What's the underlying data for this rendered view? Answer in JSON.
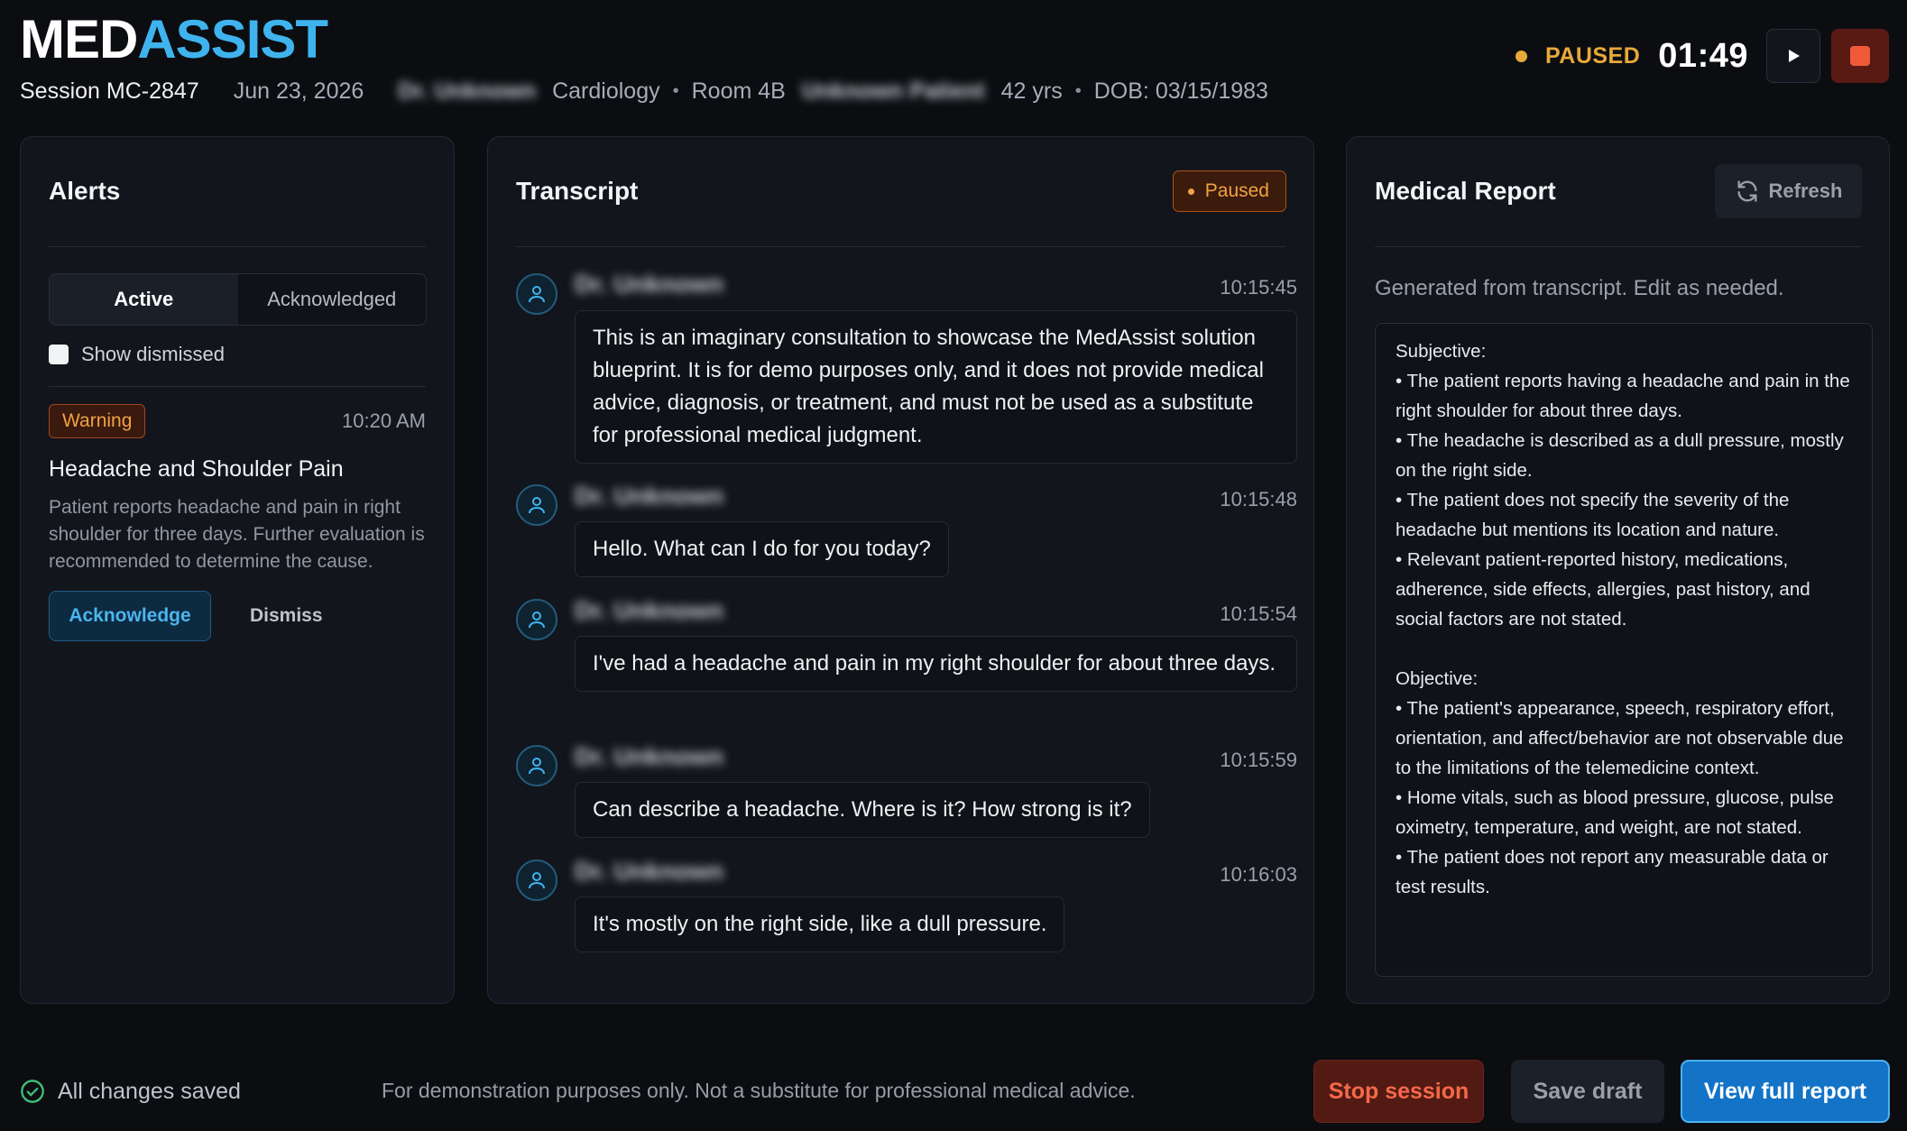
{
  "app": {
    "logo_part1": "MED",
    "logo_part2": "ASSIST"
  },
  "session": {
    "id": "Session MC-2847",
    "date": "Jun 23, 2026",
    "doctor": "Dr. Unknown",
    "department": "Cardiology",
    "room": "Room 4B",
    "patient": "Unknown Patient",
    "age": "42 yrs",
    "dob": "DOB: 03/15/1983"
  },
  "status": {
    "label": "PAUSED",
    "timer": "01:49"
  },
  "alerts": {
    "title": "Alerts",
    "tabs": [
      {
        "label": "Active",
        "active": true
      },
      {
        "label": "Acknowledged",
        "active": false
      }
    ],
    "show_dismissed": "Show dismissed",
    "items": [
      {
        "severity": "Warning",
        "time": "10:20 AM",
        "title": "Headache and Shoulder Pain",
        "body": "Patient reports headache and pain in right shoulder for three days. Further evaluation is recommended to determine the cause.",
        "acknowledge": "Acknowledge",
        "dismiss": "Dismiss"
      }
    ]
  },
  "transcript": {
    "title": "Transcript",
    "badge": "Paused",
    "messages": [
      {
        "speaker": "Dr. Unknown",
        "time": "10:15:45",
        "text": "This is an imaginary consultation to showcase the MedAssist solution blueprint. It is for demo purposes only, and it does not provide medical advice, diagnosis, or treatment, and must not be used as a substitute for professional medical judgment."
      },
      {
        "speaker": "Dr. Unknown",
        "time": "10:15:48",
        "text": "Hello. What can I do for you today?"
      },
      {
        "speaker": "Dr. Unknown",
        "time": "10:15:54",
        "text": "I've had a headache and pain in my right shoulder for about three days."
      },
      {
        "speaker": "Dr. Unknown",
        "time": "10:15:59",
        "text": "Can describe a headache. Where is it? How strong is it?"
      },
      {
        "speaker": "Dr. Unknown",
        "time": "10:16:03",
        "text": "It's mostly on the right side, like a dull pressure."
      }
    ]
  },
  "report": {
    "title": "Medical Report",
    "refresh": "Refresh",
    "note": "Generated from transcript. Edit as needed.",
    "subjective_heading": "Subjective:",
    "subjective": [
      "• The patient reports having a headache and pain in the right shoulder for about three days.",
      "• The headache is described as a dull pressure, mostly on the right side.",
      "• The patient does not specify the severity of the headache but mentions its location and nature.",
      "• Relevant patient-reported history, medications, adherence, side effects, allergies, past history, and social factors are not stated."
    ],
    "objective_heading": "Objective:",
    "objective": [
      "• The patient's appearance, speech, respiratory effort, orientation, and affect/behavior are not observable due to the limitations of the telemedicine context.",
      "• Home vitals, such as blood pressure, glucose, pulse oximetry, temperature, and weight, are not stated.",
      "• The patient does not report any measurable data or test results."
    ]
  },
  "footer": {
    "saved": "All changes saved",
    "disclaimer": "For demonstration purposes only. Not a substitute for professional medical advice.",
    "stop": "Stop session",
    "save": "Save draft",
    "view": "View full report"
  },
  "colors": {
    "accent": "#3fb3ee",
    "warning": "#f2a144",
    "danger": "#f4694a",
    "primary": "#1273c7"
  }
}
